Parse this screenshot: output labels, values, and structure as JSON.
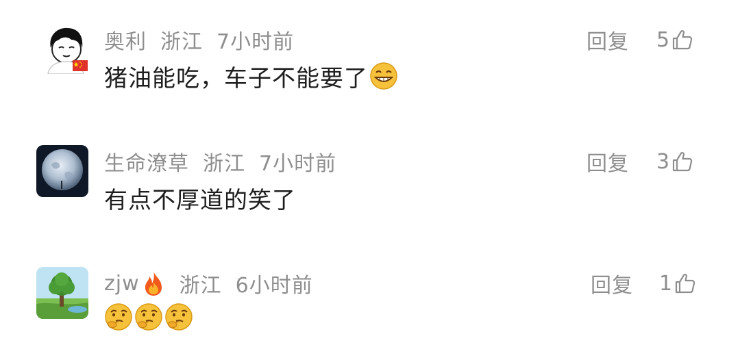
{
  "comments": [
    {
      "username": "奥利",
      "location": "浙江",
      "time": "7小时前",
      "reply_label": "回复",
      "likes": "5",
      "content": "猪油能吃，车子不能要了",
      "content_emoji": "grinning-emoji",
      "avatar": "cartoon-face-avatar",
      "badge": "china-flag-icon"
    },
    {
      "username": "生命潦草",
      "location": "浙江",
      "time": "7小时前",
      "reply_label": "回复",
      "likes": "3",
      "content": "有点不厚道的笑了",
      "avatar": "earth-at-night-avatar"
    },
    {
      "username": "zjw",
      "username_emoji": "fire-emoji",
      "location": "浙江",
      "time": "6小时前",
      "reply_label": "回复",
      "likes": "1",
      "content_emojis": [
        "thinking-emoji",
        "thinking-emoji",
        "thinking-emoji"
      ],
      "avatar": "tree-landscape-avatar"
    }
  ],
  "colors": {
    "meta_text": "#8e8e8e",
    "content_text": "#1e1e1e",
    "background": "#ffffff"
  }
}
